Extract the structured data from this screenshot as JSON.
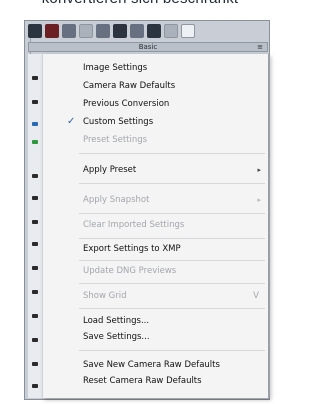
{
  "caption": "konvertieren sich beschränkt",
  "toolbar": {
    "icons": [
      "circle-icon",
      "brush-icon",
      "gradient-icon",
      "list-icon",
      "histogram-icon",
      "image-icon",
      "fx-icon",
      "camera-icon",
      "grid-icon",
      "preset-icon"
    ]
  },
  "panel_tab": {
    "label": "Basic",
    "menu_arrow": "≡"
  },
  "menu": {
    "items": [
      {
        "label": "Image Settings",
        "enabled": true
      },
      {
        "label": "Camera Raw Defaults",
        "enabled": true
      },
      {
        "label": "Previous Conversion",
        "enabled": true
      },
      {
        "label": "Custom Settings",
        "enabled": true,
        "checked": true,
        "check_glyph": "✓"
      },
      {
        "label": "Preset Settings",
        "enabled": false
      },
      {
        "label": "Apply Preset",
        "enabled": true,
        "submenu": "▸"
      },
      {
        "label": "Apply Snapshot",
        "enabled": false,
        "submenu": "▸"
      },
      {
        "label": "Clear Imported Settings",
        "enabled": false
      },
      {
        "label": "Export Settings to XMP",
        "enabled": true
      },
      {
        "label": "Update DNG Previews",
        "enabled": false
      },
      {
        "label": "Show Grid",
        "enabled": false,
        "shortcut": "V"
      },
      {
        "label": "Load Settings...",
        "enabled": true
      },
      {
        "label": "Save Settings...",
        "enabled": true
      },
      {
        "label": "Save New Camera Raw Defaults",
        "enabled": true
      },
      {
        "label": "Reset Camera Raw Defaults",
        "enabled": true
      }
    ]
  }
}
